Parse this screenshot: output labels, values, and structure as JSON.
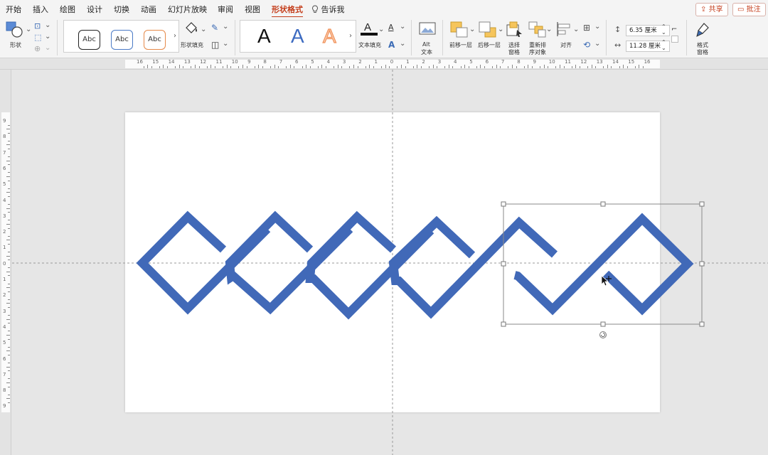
{
  "menu": {
    "tabs": [
      "开始",
      "插入",
      "绘图",
      "设计",
      "切换",
      "动画",
      "幻灯片放映",
      "审阅",
      "视图",
      "形状格式"
    ],
    "active_tab": "形状格式",
    "tell_me": "告诉我",
    "share_label": "共享",
    "comments_label": "批注"
  },
  "ribbon": {
    "shapes_label": "形状",
    "style_sample": "Abc",
    "shape_fill_label": "形状填充",
    "wordart_sample": "A",
    "text_fill_label": "文本填充",
    "alt_text_line1": "Alt",
    "alt_text_line2": "文本",
    "bring_forward_label": "前移一层",
    "send_backward_label": "后移一层",
    "selection_pane_line1": "选择",
    "selection_pane_line2": "窗格",
    "reorder_line1": "重新排",
    "reorder_line2": "序对象",
    "align_label": "对齐",
    "height_value": "6.35 厘米",
    "width_value": "11.28 厘米",
    "format_pane_line1": "格式",
    "format_pane_line2": "窗格"
  },
  "ruler": {
    "h_labels": [
      "16",
      "15",
      "14",
      "13",
      "12",
      "11",
      "10",
      "9",
      "8",
      "7",
      "6",
      "5",
      "4",
      "3",
      "2",
      "1",
      "0",
      "1",
      "2",
      "3",
      "4",
      "5",
      "6",
      "7",
      "8",
      "9",
      "10",
      "11",
      "12",
      "13",
      "14",
      "15",
      "16"
    ],
    "v_labels": [
      "9",
      "8",
      "7",
      "6",
      "5",
      "4",
      "3",
      "2",
      "1",
      "0",
      "1",
      "2",
      "3",
      "4",
      "5",
      "6",
      "7",
      "8",
      "9"
    ]
  },
  "colors": {
    "shape_blue": "#4169b8",
    "accent_red": "#c43e1c",
    "wordart_blue": "#3d6bc1",
    "wordart_orange": "#f0915a"
  }
}
